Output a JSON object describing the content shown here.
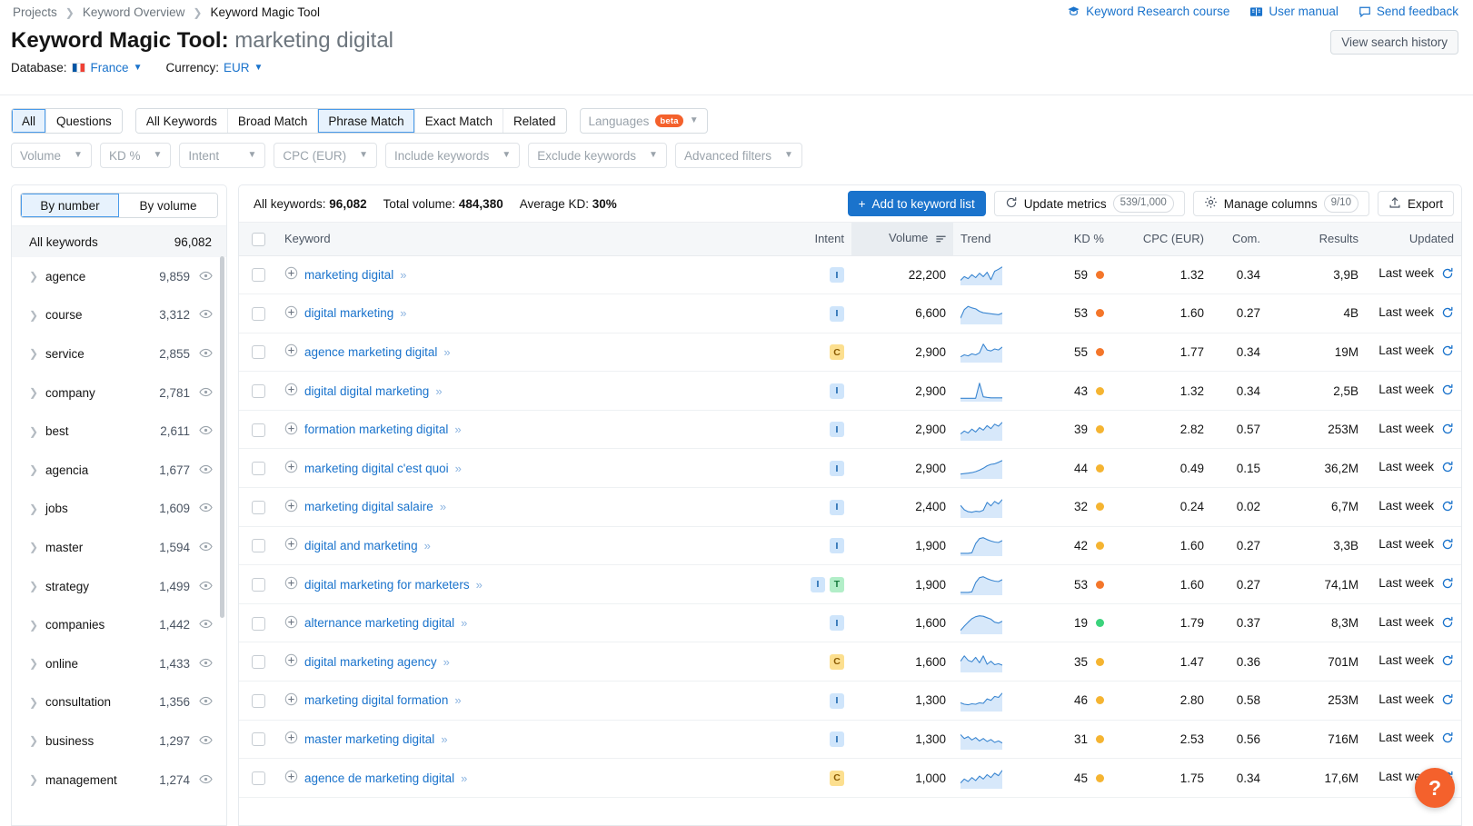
{
  "breadcrumb": [
    {
      "label": "Projects",
      "current": false
    },
    {
      "label": "Keyword Overview",
      "current": false
    },
    {
      "label": "Keyword Magic Tool",
      "current": true
    }
  ],
  "header_links": [
    {
      "label": "Keyword Research course",
      "icon": "graduation-cap-icon"
    },
    {
      "label": "User manual",
      "icon": "book-icon"
    },
    {
      "label": "Send feedback",
      "icon": "comment-icon"
    }
  ],
  "title": {
    "main": "Keyword Magic Tool:",
    "query": "marketing digital",
    "view_history_label": "View search history"
  },
  "settings": {
    "database_label": "Database:",
    "database_value": "France",
    "database_flag": "flag-france-icon",
    "currency_label": "Currency:",
    "currency_value": "EUR"
  },
  "tabs": {
    "group1": [
      {
        "label": "All",
        "active": true
      },
      {
        "label": "Questions",
        "active": false
      }
    ],
    "group2": [
      {
        "label": "All Keywords",
        "active": false
      },
      {
        "label": "Broad Match",
        "active": false
      },
      {
        "label": "Phrase Match",
        "active": true
      },
      {
        "label": "Exact Match",
        "active": false
      },
      {
        "label": "Related",
        "active": false
      }
    ],
    "languages": {
      "label": "Languages",
      "badge": "beta"
    }
  },
  "filters": [
    {
      "label": "Volume"
    },
    {
      "label": "KD %"
    },
    {
      "label": "Intent"
    },
    {
      "label": "CPC (EUR)"
    },
    {
      "label": "Include keywords"
    },
    {
      "label": "Exclude keywords"
    },
    {
      "label": "Advanced filters"
    }
  ],
  "sidebar": {
    "segments": [
      {
        "label": "By number",
        "active": true
      },
      {
        "label": "By volume",
        "active": false
      }
    ],
    "all_keywords": {
      "label": "All keywords",
      "count": "96,082"
    },
    "groups": [
      {
        "label": "agence",
        "count": "9,859"
      },
      {
        "label": "course",
        "count": "3,312"
      },
      {
        "label": "service",
        "count": "2,855"
      },
      {
        "label": "company",
        "count": "2,781"
      },
      {
        "label": "best",
        "count": "2,611"
      },
      {
        "label": "agencia",
        "count": "1,677"
      },
      {
        "label": "jobs",
        "count": "1,609"
      },
      {
        "label": "master",
        "count": "1,594"
      },
      {
        "label": "strategy",
        "count": "1,499"
      },
      {
        "label": "companies",
        "count": "1,442"
      },
      {
        "label": "online",
        "count": "1,433"
      },
      {
        "label": "consultation",
        "count": "1,356"
      },
      {
        "label": "business",
        "count": "1,297"
      },
      {
        "label": "management",
        "count": "1,274"
      }
    ]
  },
  "summary": {
    "all_keywords_label": "All keywords:",
    "all_keywords_value": "96,082",
    "total_volume_label": "Total volume:",
    "total_volume_value": "484,380",
    "average_kd_label": "Average KD:",
    "average_kd_value": "30%",
    "add_to_list_label": "Add to keyword list",
    "update_metrics_label": "Update metrics",
    "update_metrics_count": "539/1,000",
    "manage_columns_label": "Manage columns",
    "manage_columns_count": "9/10",
    "export_label": "Export"
  },
  "table": {
    "columns": [
      "Keyword",
      "Intent",
      "Volume",
      "Trend",
      "KD %",
      "CPC (EUR)",
      "Com.",
      "Results",
      "Updated"
    ],
    "sorted_column": "Volume",
    "rows": [
      {
        "keyword": "marketing digital",
        "intent": [
          "I"
        ],
        "volume": "22,200",
        "kd": "59",
        "kd_color": "#f4762a",
        "cpc": "1.32",
        "com": "0.34",
        "results": "3,9B",
        "updated": "Last week",
        "trend": "15,30,22,38,26,44,30,48,18,52,60,70"
      },
      {
        "keyword": "digital marketing",
        "intent": [
          "I"
        ],
        "volume": "6,600",
        "kd": "53",
        "kd_color": "#f4762a",
        "cpc": "1.60",
        "com": "0.27",
        "results": "4B",
        "updated": "Last week",
        "trend": "20,55,68,62,58,48,42,40,38,36,34,40"
      },
      {
        "keyword": "agence marketing digital",
        "intent": [
          "C"
        ],
        "volume": "2,900",
        "kd": "55",
        "kd_color": "#f4762a",
        "cpc": "1.77",
        "com": "0.34",
        "results": "19M",
        "updated": "Last week",
        "trend": "18,26,22,30,26,34,70,46,42,50,46,58"
      },
      {
        "keyword": "digital digital marketing",
        "intent": [
          "I"
        ],
        "volume": "2,900",
        "kd": "43",
        "kd_color": "#f5b431",
        "cpc": "1.32",
        "com": "0.34",
        "results": "2,5B",
        "updated": "Last week",
        "trend": "8,8,8,8,8,70,14,12,10,10,10,10"
      },
      {
        "keyword": "formation marketing digital",
        "intent": [
          "I"
        ],
        "volume": "2,900",
        "kd": "39",
        "kd_color": "#f5b431",
        "cpc": "2.82",
        "com": "0.57",
        "results": "253M",
        "updated": "Last week",
        "trend": "22,34,26,42,30,48,38,56,44,62,54,70"
      },
      {
        "keyword": "marketing digital c'est quoi",
        "intent": [
          "I"
        ],
        "volume": "2,900",
        "kd": "44",
        "kd_color": "#f5b431",
        "cpc": "0.49",
        "com": "0.15",
        "results": "36,2M",
        "updated": "Last week",
        "trend": "14,16,18,20,24,30,38,48,54,56,62,70"
      },
      {
        "keyword": "marketing digital salaire",
        "intent": [
          "I"
        ],
        "volume": "2,400",
        "kd": "32",
        "kd_color": "#f5b431",
        "cpc": "0.24",
        "com": "0.02",
        "results": "6,7M",
        "updated": "Last week",
        "trend": "46,28,20,18,22,20,26,58,44,62,52,70"
      },
      {
        "keyword": "digital and marketing",
        "intent": [
          "I"
        ],
        "volume": "1,900",
        "kd": "42",
        "kd_color": "#f5b431",
        "cpc": "1.60",
        "com": "0.27",
        "results": "3,3B",
        "updated": "Last week",
        "trend": "6,6,6,8,46,66,70,62,56,52,50,58"
      },
      {
        "keyword": "digital marketing for marketers",
        "intent": [
          "I",
          "T"
        ],
        "volume": "1,900",
        "kd": "53",
        "kd_color": "#f4762a",
        "cpc": "1.60",
        "com": "0.27",
        "results": "74,1M",
        "updated": "Last week",
        "trend": "6,6,6,8,46,66,70,62,56,52,50,58"
      },
      {
        "keyword": "alternance marketing digital",
        "intent": [
          "I"
        ],
        "volume": "1,600",
        "kd": "19",
        "kd_color": "#3bd37c",
        "cpc": "1.79",
        "com": "0.37",
        "results": "8,3M",
        "updated": "Last week",
        "trend": "10,28,44,58,66,70,68,62,56,44,40,48"
      },
      {
        "keyword": "digital marketing agency",
        "intent": [
          "C"
        ],
        "volume": "1,600",
        "kd": "35",
        "kd_color": "#f5b431",
        "cpc": "1.47",
        "com": "0.36",
        "results": "701M",
        "updated": "Last week",
        "trend": "40,62,44,38,56,34,62,28,40,26,30,24"
      },
      {
        "keyword": "marketing digital formation",
        "intent": [
          "I"
        ],
        "volume": "1,300",
        "kd": "46",
        "kd_color": "#f5b431",
        "cpc": "2.80",
        "com": "0.58",
        "results": "253M",
        "updated": "Last week",
        "trend": "30,24,22,26,24,30,28,46,40,56,52,70"
      },
      {
        "keyword": "master marketing digital",
        "intent": [
          "I"
        ],
        "volume": "1,300",
        "kd": "31",
        "kd_color": "#f5b431",
        "cpc": "2.53",
        "com": "0.56",
        "results": "716M",
        "updated": "Last week",
        "trend": "56,40,48,34,44,30,40,28,36,24,30,22"
      },
      {
        "keyword": "agence de marketing digital",
        "intent": [
          "C"
        ],
        "volume": "1,000",
        "kd": "45",
        "kd_color": "#f5b431",
        "cpc": "1.75",
        "com": "0.34",
        "results": "17,6M",
        "updated": "Last week",
        "trend": "18,34,24,40,28,46,34,52,40,58,48,70"
      }
    ]
  },
  "help": {
    "label": "?"
  },
  "colors": {
    "accent": "#1a73cc",
    "kd_easy": "#3bd37c",
    "kd_medium": "#f5b431",
    "kd_hard": "#f4762a",
    "beta_badge": "#f4612c",
    "help_fab": "#f4612c"
  }
}
